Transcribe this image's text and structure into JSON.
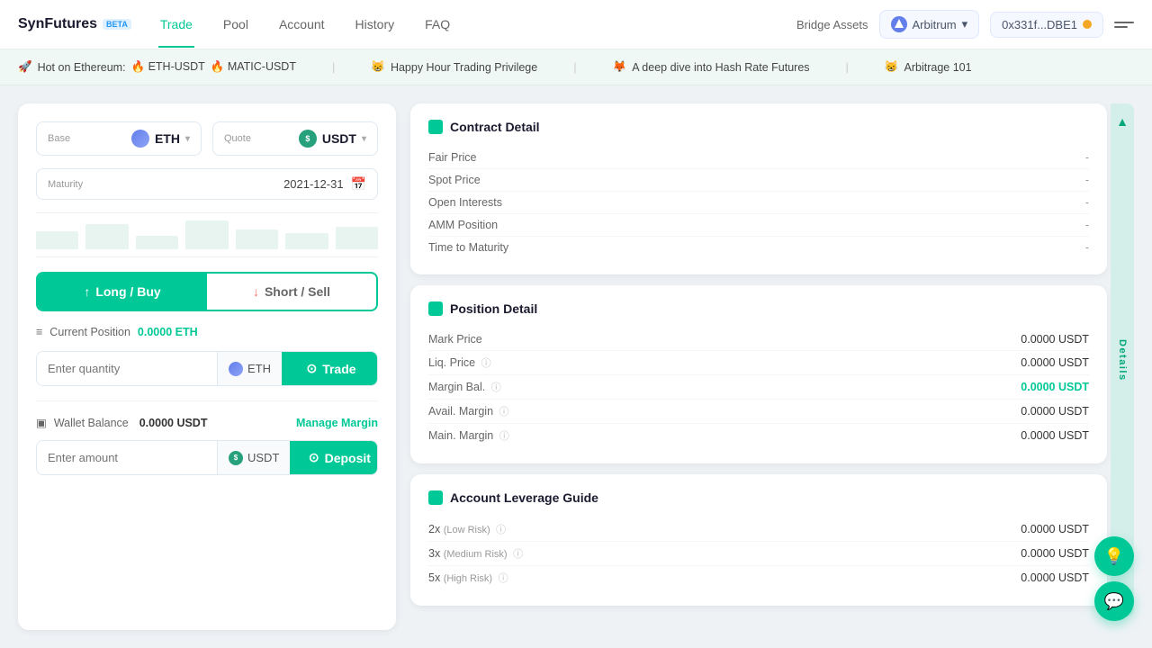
{
  "header": {
    "logo_text": "SynFutures",
    "logo_beta": "BETA",
    "nav": [
      {
        "label": "Trade",
        "active": true
      },
      {
        "label": "Pool",
        "active": false
      },
      {
        "label": "Account",
        "active": false
      },
      {
        "label": "History",
        "active": false
      },
      {
        "label": "FAQ",
        "active": false
      }
    ],
    "bridge_label": "Bridge Assets",
    "network_label": "Arbitrum",
    "wallet_address": "0x331f...DBE1"
  },
  "ticker": {
    "items": [
      {
        "emoji": "🚀",
        "text": "Hot on Ethereum:",
        "links": [
          "🔥 ETH-USDT",
          "🔥 MATIC-USDT"
        ]
      },
      {
        "emoji": "😸",
        "text": "Happy Hour Trading Privilege"
      },
      {
        "emoji": "🦊",
        "text": "A deep dive into Hash Rate Futures"
      },
      {
        "emoji": "😸",
        "text": "Arbitrage 101"
      }
    ]
  },
  "trade_panel": {
    "base_label": "Base",
    "base_value": "ETH",
    "quote_label": "Quote",
    "quote_value": "USDT",
    "maturity_label": "Maturity",
    "maturity_value": "2021-12-31",
    "btn_long": "Long / Buy",
    "btn_short": "Short / Sell",
    "current_position_label": "Current Position",
    "current_position_value": "0.0000 ETH",
    "quantity_placeholder": "Enter quantity",
    "quantity_unit": "ETH",
    "trade_btn_label": "Trade",
    "wallet_label": "Wallet Balance",
    "wallet_value": "0.0000 USDT",
    "manage_margin_label": "Manage Margin",
    "amount_placeholder": "Enter amount",
    "amount_unit": "USDT",
    "deposit_btn_label": "Deposit"
  },
  "contract_detail": {
    "title": "Contract Detail",
    "rows": [
      {
        "label": "Fair Price",
        "value": "-"
      },
      {
        "label": "Spot Price",
        "value": "-"
      },
      {
        "label": "Open Interests",
        "value": "-"
      },
      {
        "label": "AMM Position",
        "value": "-"
      },
      {
        "label": "Time to Maturity",
        "value": "-"
      }
    ]
  },
  "position_detail": {
    "title": "Position Detail",
    "rows": [
      {
        "label": "Mark Price",
        "value": "0.0000 USDT",
        "green": false,
        "info": false
      },
      {
        "label": "Liq. Price",
        "value": "0.0000 USDT",
        "green": false,
        "info": true
      },
      {
        "label": "Margin Bal.",
        "value": "0.0000 USDT",
        "green": true,
        "info": true
      },
      {
        "label": "Avail. Margin",
        "value": "0.0000 USDT",
        "green": false,
        "info": true
      },
      {
        "label": "Main. Margin",
        "value": "0.0000 USDT",
        "green": false,
        "info": true
      }
    ]
  },
  "leverage_guide": {
    "title": "Account Leverage Guide",
    "rows": [
      {
        "label": "2x",
        "tag": "(Low Risk)",
        "value": "0.0000 USDT",
        "info": true
      },
      {
        "label": "3x",
        "tag": "(Medium Risk)",
        "value": "0.0000 USDT",
        "info": true
      },
      {
        "label": "5x",
        "tag": "(High Risk)",
        "value": "0.0000 USDT",
        "info": true
      }
    ]
  },
  "side_panel": {
    "label": "Details"
  },
  "icons": {
    "eth": "Ξ",
    "usdt": "$",
    "long_arrow": "↑",
    "short_arrow": "↓",
    "calendar": "📅",
    "trade_circle": "⊙",
    "deposit_circle": "⊙",
    "chat": "💬",
    "bulb": "💡",
    "info": "ⓘ",
    "chevron_down": "▾",
    "collapse_left": "◀",
    "bar_icon": "≡",
    "pos_icon": "≡"
  }
}
